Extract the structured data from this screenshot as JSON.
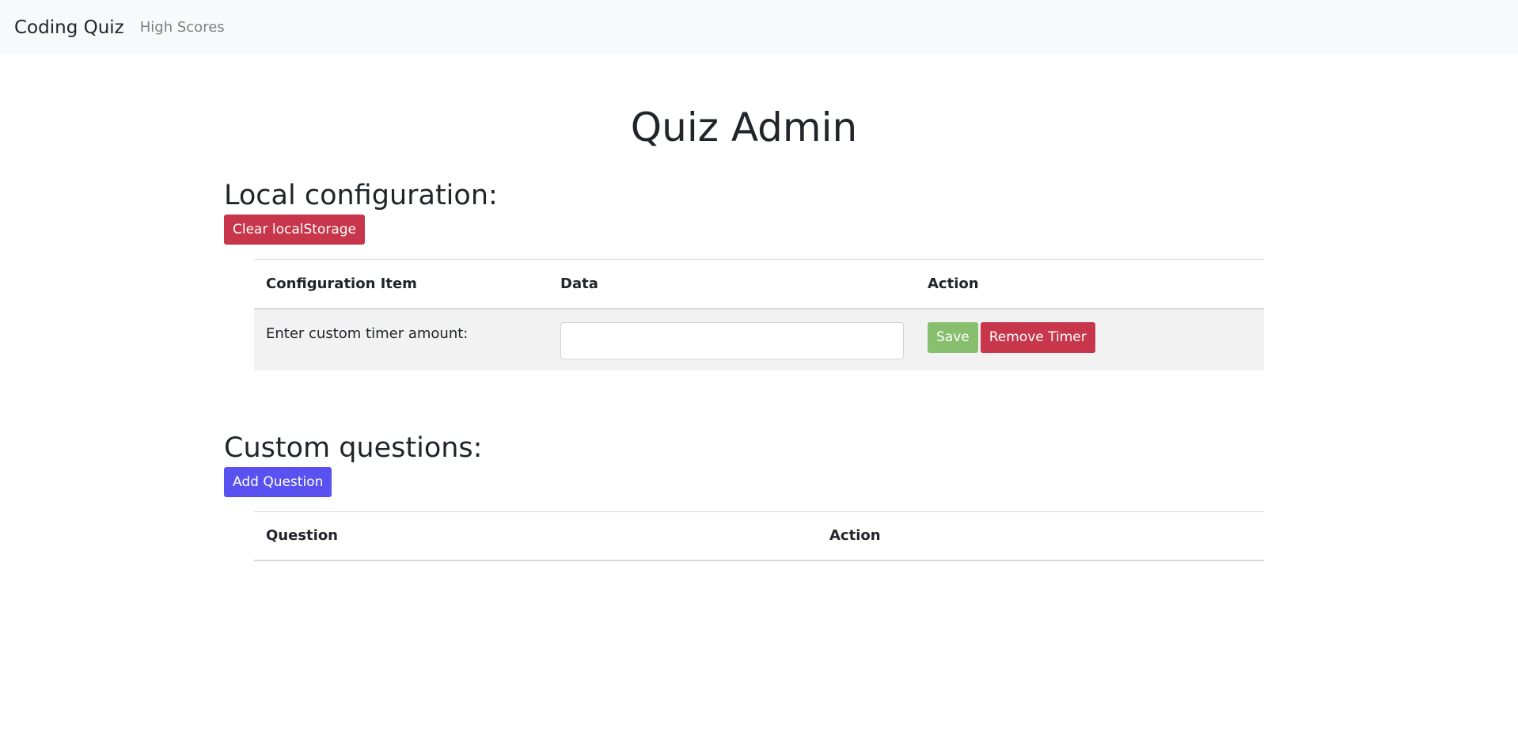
{
  "navbar": {
    "brand": "Coding Quiz",
    "links": [
      "High Scores"
    ]
  },
  "page": {
    "title": "Quiz Admin"
  },
  "local_config": {
    "heading": "Local configuration:",
    "clear_button": "Clear localStorage",
    "columns": [
      "Configuration Item",
      "Data",
      "Action"
    ],
    "rows": [
      {
        "item": "Enter custom timer amount:",
        "input_value": "",
        "save_label": "Save",
        "remove_label": "Remove Timer"
      }
    ]
  },
  "custom_questions": {
    "heading": "Custom questions:",
    "add_button": "Add Question",
    "columns": [
      "Question",
      "Action"
    ]
  },
  "colors": {
    "danger": "#c7364a",
    "success": "#87bf6e",
    "primary": "#5a52f0",
    "navbar_bg": "#f8f9fa"
  }
}
